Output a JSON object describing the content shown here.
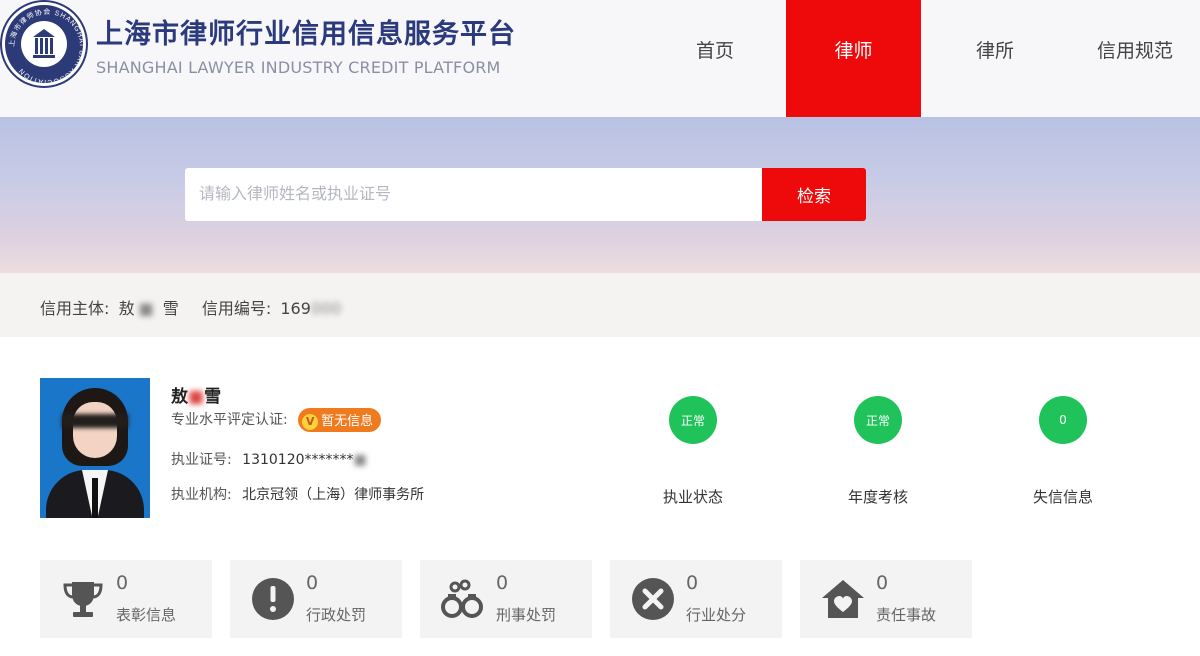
{
  "header": {
    "site_title": "上海市律师行业信用信息服务平台",
    "site_subtitle": "SHANGHAI LAWYER INDUSTRY CREDIT PLATFORM",
    "logo_ring_text": "上海市律师协会 SHANGHAI BAR ASSOCIATION",
    "nav": [
      {
        "label": "首页",
        "active": false
      },
      {
        "label": "律师",
        "active": true
      },
      {
        "label": "律所",
        "active": false
      },
      {
        "label": "信用规范",
        "active": false
      }
    ],
    "accent_color": "#ee0a0a"
  },
  "search": {
    "placeholder": "请输入律师姓名或执业证号",
    "button_label": "检索"
  },
  "subject": {
    "subject_label": "信用主体:",
    "subject_value_a": "敖",
    "subject_value_b": "雪",
    "number_label": "信用编号:",
    "number_value": "169",
    "number_masked": "000"
  },
  "profile": {
    "name_a": "敖",
    "name_b": "雪",
    "cert_label": "专业水平评定认证:",
    "cert_badge_icon": "V",
    "cert_badge_text": "暂无信息",
    "license_label": "执业证号:",
    "license_value": "1310120*******",
    "org_label": "执业机构:",
    "org_value": "北京冠领（上海）律师事务所"
  },
  "statuses": [
    {
      "value": "正常",
      "label": "执业状态"
    },
    {
      "value": "正常",
      "label": "年度考核"
    },
    {
      "value": "0",
      "label": "失信信息"
    }
  ],
  "status_color": "#1fc35a",
  "records": [
    {
      "icon": "trophy-icon",
      "count": "0",
      "label": "表彰信息"
    },
    {
      "icon": "exclamation-icon",
      "count": "0",
      "label": "行政处罚"
    },
    {
      "icon": "handcuffs-icon",
      "count": "0",
      "label": "刑事处罚"
    },
    {
      "icon": "x-circle-icon",
      "count": "0",
      "label": "行业处分"
    },
    {
      "icon": "house-heart-icon",
      "count": "0",
      "label": "责任事故"
    }
  ]
}
